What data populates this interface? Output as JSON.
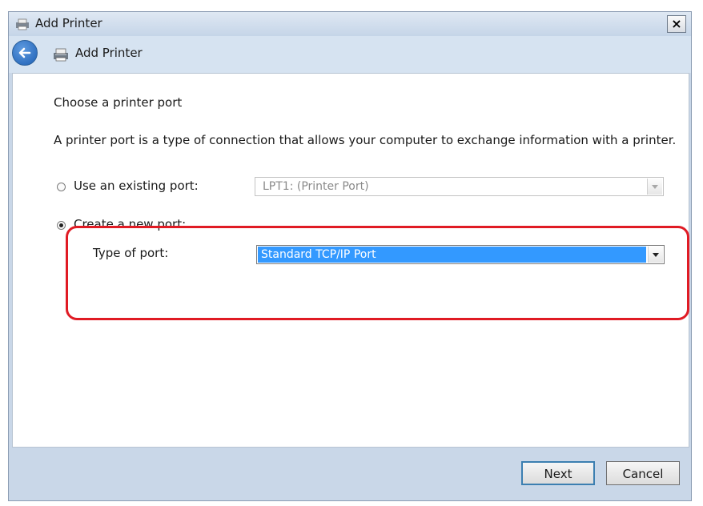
{
  "window": {
    "title": "Add Printer",
    "close_glyph": "×"
  },
  "nav": {
    "title": "Add Printer",
    "back_icon": "back-arrow-icon",
    "printer_icon": "printer-icon"
  },
  "content": {
    "heading": "Choose a printer port",
    "description": "A printer port is a type of connection that allows your computer to exchange information with a printer.",
    "existing_port": {
      "label": "Use an existing port:",
      "selected": false,
      "value": "LPT1: (Printer Port)",
      "enabled": false
    },
    "new_port": {
      "label": "Create a new port:",
      "selected": true,
      "type_label": "Type of port:",
      "value": "Standard TCP/IP Port"
    }
  },
  "footer": {
    "next_label": "Next",
    "cancel_label": "Cancel"
  },
  "colors": {
    "highlight": "#e01b24",
    "selection": "#3399ff"
  }
}
